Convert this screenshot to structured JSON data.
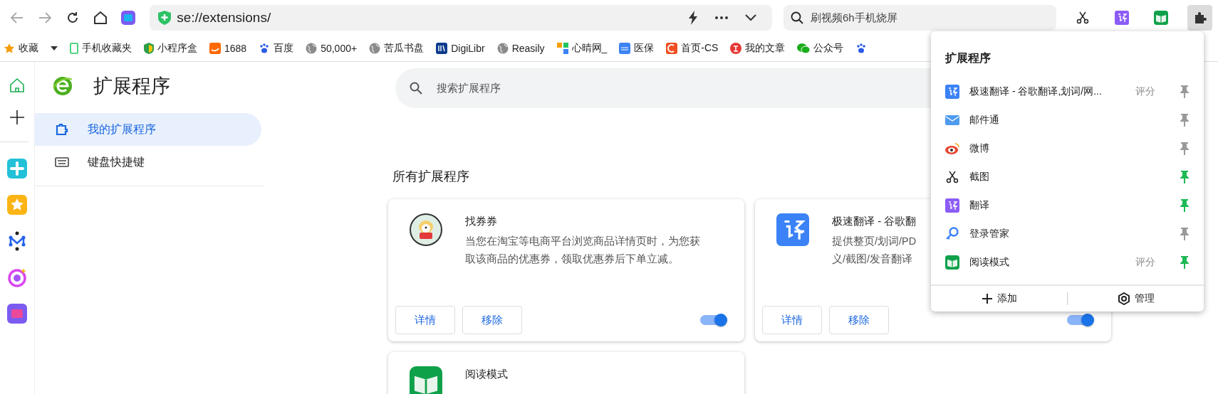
{
  "toolbar": {
    "address": "se://extensions/",
    "search": "刷视频6h手机烧屏",
    "extensions": [
      {
        "kind": "scissors",
        "active": false
      },
      {
        "kind": "translate",
        "active": false
      },
      {
        "kind": "book",
        "active": false
      },
      {
        "kind": "puzzle",
        "active": true
      }
    ]
  },
  "bookmarks": [
    {
      "label": "收藏",
      "kind": "star",
      "menu": true
    },
    {
      "label": "手机收藏夹",
      "kind": "phone",
      "menu": false
    },
    {
      "label": "小程序盒",
      "kind": "shield",
      "menu": false
    },
    {
      "label": "1688",
      "kind": "ali",
      "menu": false
    },
    {
      "label": "百度",
      "kind": "paw",
      "menu": false
    },
    {
      "label": "50,000+",
      "kind": "globe",
      "menu": false
    },
    {
      "label": "苦瓜书盘",
      "kind": "globe",
      "menu": false
    },
    {
      "label": "DigiLibr",
      "kind": "library",
      "menu": false
    },
    {
      "label": "Reasily",
      "kind": "globe",
      "menu": false
    },
    {
      "label": "心晴网_",
      "kind": "tiles",
      "menu": false
    },
    {
      "label": "医保",
      "kind": "chs",
      "menu": false
    },
    {
      "label": "首页-CS",
      "kind": "c",
      "menu": false
    },
    {
      "label": "我的文章",
      "kind": "zhi",
      "menu": false
    },
    {
      "label": "公众号",
      "kind": "wechat",
      "menu": false
    },
    {
      "kind": "paw",
      "menu": false
    }
  ],
  "rail": [
    {
      "kind": "home"
    },
    {
      "kind": "plus"
    },
    {
      "kind": "divider"
    },
    {
      "kind": "cross"
    },
    {
      "kind": "star"
    },
    {
      "kind": "network"
    },
    {
      "kind": "ai-ring"
    },
    {
      "kind": "ai"
    }
  ],
  "sidebar": {
    "title": "扩展程序",
    "items": [
      {
        "label": "我的扩展程序",
        "kind": "puzzle",
        "selected": true
      },
      {
        "label": "键盘快捷键",
        "kind": "keyboard",
        "selected": false
      }
    ]
  },
  "search": {
    "placeholder": "搜索扩展程序"
  },
  "section_title": "所有扩展程序",
  "cards": [
    {
      "kind": "dog",
      "title": "找券券",
      "lines": [
        "当您在淘宝等电商平台浏览商品详情页时，为您获",
        "取该商品的优惠券，领取优惠券后下单立减。"
      ],
      "buttons": [
        "详情",
        "移除"
      ],
      "on": true
    },
    {
      "kind": "translate",
      "title": "极速翻译 - 谷歌翻",
      "lines": [
        "提供整页/划词/PD",
        "义/截图/发音翻译"
      ],
      "buttons": [
        "详情",
        "移除"
      ],
      "on": true
    },
    {
      "kind": "book",
      "title": "阅读模式"
    }
  ],
  "popup": {
    "title": "扩展程序",
    "items": [
      {
        "kind": "translate-blue",
        "name": "极速翻译 - 谷歌翻译,划词/网...",
        "rating": "评分",
        "pinned": false
      },
      {
        "kind": "mail",
        "name": "邮件通",
        "pinned": false
      },
      {
        "kind": "weibo",
        "name": "微博",
        "pinned": false
      },
      {
        "kind": "scissors",
        "name": "截图",
        "pinned": true
      },
      {
        "kind": "translate-purple",
        "name": "翻译",
        "pinned": true
      },
      {
        "kind": "key",
        "name": "登录管家",
        "pinned": false
      },
      {
        "kind": "book",
        "name": "阅读模式",
        "rating": "评分",
        "pinned": true
      }
    ],
    "add": "添加",
    "manage": "管理"
  }
}
